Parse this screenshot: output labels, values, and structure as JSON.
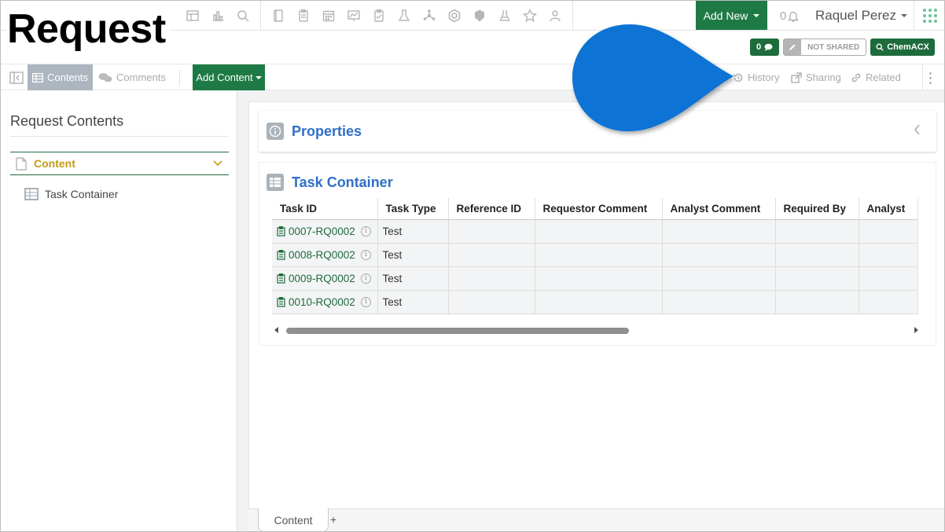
{
  "page_title": "Request",
  "header": {
    "top_icons": [
      "dashboard-icon",
      "chart-icon",
      "search-icon",
      "notebook-icon",
      "clipboard-icon",
      "calendar-icon",
      "presentation-icon",
      "checklist-icon",
      "flask-icon",
      "molecule-icon",
      "hexagon-icon",
      "shield-icon",
      "beaker-icon",
      "star-icon",
      "user-group-icon"
    ],
    "add_new_label": "Add New",
    "notification_count": "0",
    "user_name": "Raquel Perez"
  },
  "badges": {
    "comment_count": "0",
    "sharing_status": "NOT SHARED",
    "chem_label": "ChemACX"
  },
  "toolbar": {
    "contents_tab": "Contents",
    "comments_tab": "Comments",
    "add_content_label": "Add Content",
    "history_label": "History",
    "sharing_label": "Sharing",
    "related_label": "Related"
  },
  "sidebar": {
    "title": "Request Contents",
    "section_label": "Content",
    "items": [
      {
        "label": "Task Container"
      }
    ]
  },
  "properties": {
    "title": "Properties"
  },
  "task_container": {
    "title": "Task Container",
    "columns": [
      "Task ID",
      "Task Type",
      "Reference ID",
      "Requestor Comment",
      "Analyst Comment",
      "Required By",
      "Analyst"
    ],
    "rows": [
      {
        "task_id": "0007-RQ0002",
        "task_type": "Test"
      },
      {
        "task_id": "0008-RQ0002",
        "task_type": "Test"
      },
      {
        "task_id": "0009-RQ0002",
        "task_type": "Test"
      },
      {
        "task_id": "0010-RQ0002",
        "task_type": "Test"
      }
    ]
  },
  "bottom_tabs": {
    "tab": "Content",
    "add": "+"
  },
  "colors": {
    "primary_green": "#1e7a45",
    "link_blue": "#2f6fc6",
    "callout_blue": "#0a73d4",
    "section_gold": "#c49a17"
  }
}
